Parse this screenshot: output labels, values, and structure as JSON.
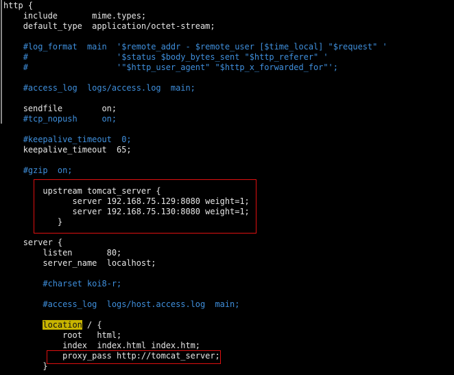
{
  "window": {
    "type": "terminal",
    "content": "nginx.conf"
  },
  "colors": {
    "background": "#000000",
    "text": "#e6e6e6",
    "comment": "#3f8fdc",
    "search_highlight": "#c8b400",
    "annotation_box": "#e01010"
  },
  "lines": [
    {
      "text": "http {",
      "type": "code"
    },
    {
      "text": "    include       mime.types;",
      "type": "code"
    },
    {
      "text": "    default_type  application/octet-stream;",
      "type": "code"
    },
    {
      "text": "",
      "type": "blank"
    },
    {
      "text": "    #log_format  main  '$remote_addr - $remote_user [$time_local] \"$request\" '",
      "type": "comment"
    },
    {
      "text": "    #                  '$status $body_bytes_sent \"$http_referer\" '",
      "type": "comment"
    },
    {
      "text": "    #                  '\"$http_user_agent\" \"$http_x_forwarded_for\"';",
      "type": "comment"
    },
    {
      "text": "",
      "type": "blank"
    },
    {
      "text": "    #access_log  logs/access.log  main;",
      "type": "comment"
    },
    {
      "text": "",
      "type": "blank"
    },
    {
      "text": "    sendfile        on;",
      "type": "code"
    },
    {
      "text": "    #tcp_nopush     on;",
      "type": "comment"
    },
    {
      "text": "",
      "type": "blank"
    },
    {
      "text": "    #keepalive_timeout  0;",
      "type": "comment"
    },
    {
      "text": "    keepalive_timeout  65;",
      "type": "code"
    },
    {
      "text": "",
      "type": "blank"
    },
    {
      "text": "    #gzip  on;",
      "type": "comment"
    },
    {
      "text": "",
      "type": "blank"
    },
    {
      "text": "        upstream tomcat_server {",
      "type": "code"
    },
    {
      "text": "              server 192.168.75.129:8080 weight=1;",
      "type": "code"
    },
    {
      "text": "              server 192.168.75.130:8080 weight=1;",
      "type": "code"
    },
    {
      "text": "           }",
      "type": "code"
    },
    {
      "text": "",
      "type": "blank"
    },
    {
      "text": "    server {",
      "type": "code"
    },
    {
      "text": "        listen       80;",
      "type": "code"
    },
    {
      "text": "        server_name  localhost;",
      "type": "code"
    },
    {
      "text": "",
      "type": "blank"
    },
    {
      "text": "        #charset koi8-r;",
      "type": "comment"
    },
    {
      "text": "",
      "type": "blank"
    },
    {
      "text": "        #access_log  logs/host.access.log  main;",
      "type": "comment"
    },
    {
      "text": "",
      "type": "blank"
    },
    {
      "text": "        location / {",
      "type": "code",
      "highlight": "location"
    },
    {
      "text": "            root   html;",
      "type": "code"
    },
    {
      "text": "            index  index.html index.htm;",
      "type": "code"
    },
    {
      "text": "            proxy_pass http://tomcat_server;",
      "type": "code"
    },
    {
      "text": "        }",
      "type": "code"
    }
  ],
  "annotations": [
    {
      "label": "upstream-block",
      "lines": [
        18,
        21
      ]
    },
    {
      "label": "proxy-pass-line",
      "lines": [
        34,
        34
      ]
    }
  ]
}
